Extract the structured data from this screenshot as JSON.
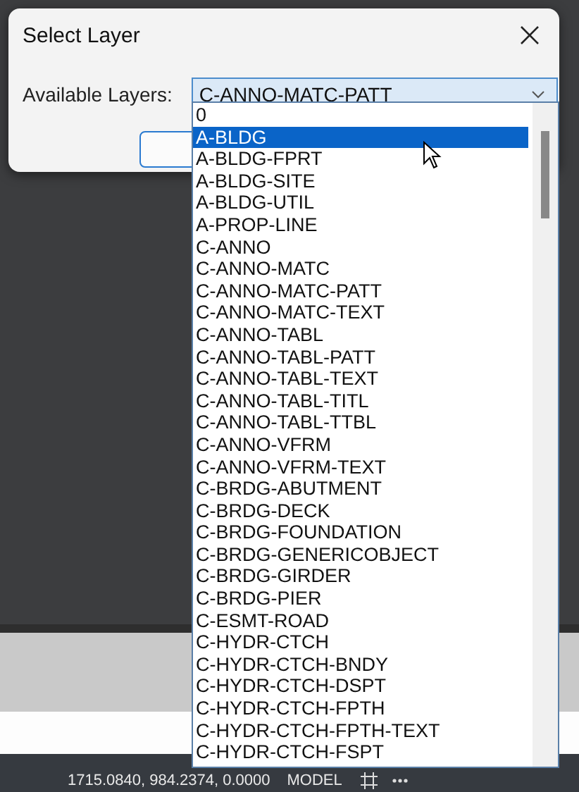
{
  "dialog": {
    "title": "Select Layer",
    "label": "Available Layers:",
    "combo": {
      "value": "C-ANNO-MATC-PATT"
    }
  },
  "dropdown": {
    "items": [
      {
        "label": "0",
        "selected": false
      },
      {
        "label": "A-BLDG",
        "selected": true
      },
      {
        "label": "A-BLDG-FPRT",
        "selected": false
      },
      {
        "label": "A-BLDG-SITE",
        "selected": false
      },
      {
        "label": "A-BLDG-UTIL",
        "selected": false
      },
      {
        "label": "A-PROP-LINE",
        "selected": false
      },
      {
        "label": "C-ANNO",
        "selected": false
      },
      {
        "label": "C-ANNO-MATC",
        "selected": false
      },
      {
        "label": "C-ANNO-MATC-PATT",
        "selected": false
      },
      {
        "label": "C-ANNO-MATC-TEXT",
        "selected": false
      },
      {
        "label": "C-ANNO-TABL",
        "selected": false
      },
      {
        "label": "C-ANNO-TABL-PATT",
        "selected": false
      },
      {
        "label": "C-ANNO-TABL-TEXT",
        "selected": false
      },
      {
        "label": "C-ANNO-TABL-TITL",
        "selected": false
      },
      {
        "label": "C-ANNO-TABL-TTBL",
        "selected": false
      },
      {
        "label": "C-ANNO-VFRM",
        "selected": false
      },
      {
        "label": "C-ANNO-VFRM-TEXT",
        "selected": false
      },
      {
        "label": "C-BRDG-ABUTMENT",
        "selected": false
      },
      {
        "label": "C-BRDG-DECK",
        "selected": false
      },
      {
        "label": "C-BRDG-FOUNDATION",
        "selected": false
      },
      {
        "label": "C-BRDG-GENERICOBJECT",
        "selected": false
      },
      {
        "label": "C-BRDG-GIRDER",
        "selected": false
      },
      {
        "label": "C-BRDG-PIER",
        "selected": false
      },
      {
        "label": "C-ESMT-ROAD",
        "selected": false
      },
      {
        "label": "C-HYDR-CTCH",
        "selected": false
      },
      {
        "label": "C-HYDR-CTCH-BNDY",
        "selected": false
      },
      {
        "label": "C-HYDR-CTCH-DSPT",
        "selected": false
      },
      {
        "label": "C-HYDR-CTCH-FPTH",
        "selected": false
      },
      {
        "label": "C-HYDR-CTCH-FPTH-TEXT",
        "selected": false
      },
      {
        "label": "C-HYDR-CTCH-FSPT",
        "selected": false
      }
    ]
  },
  "status_bar": {
    "coordinates": "1715.0840, 984.2374, 0.0000",
    "mode": "MODEL"
  }
}
